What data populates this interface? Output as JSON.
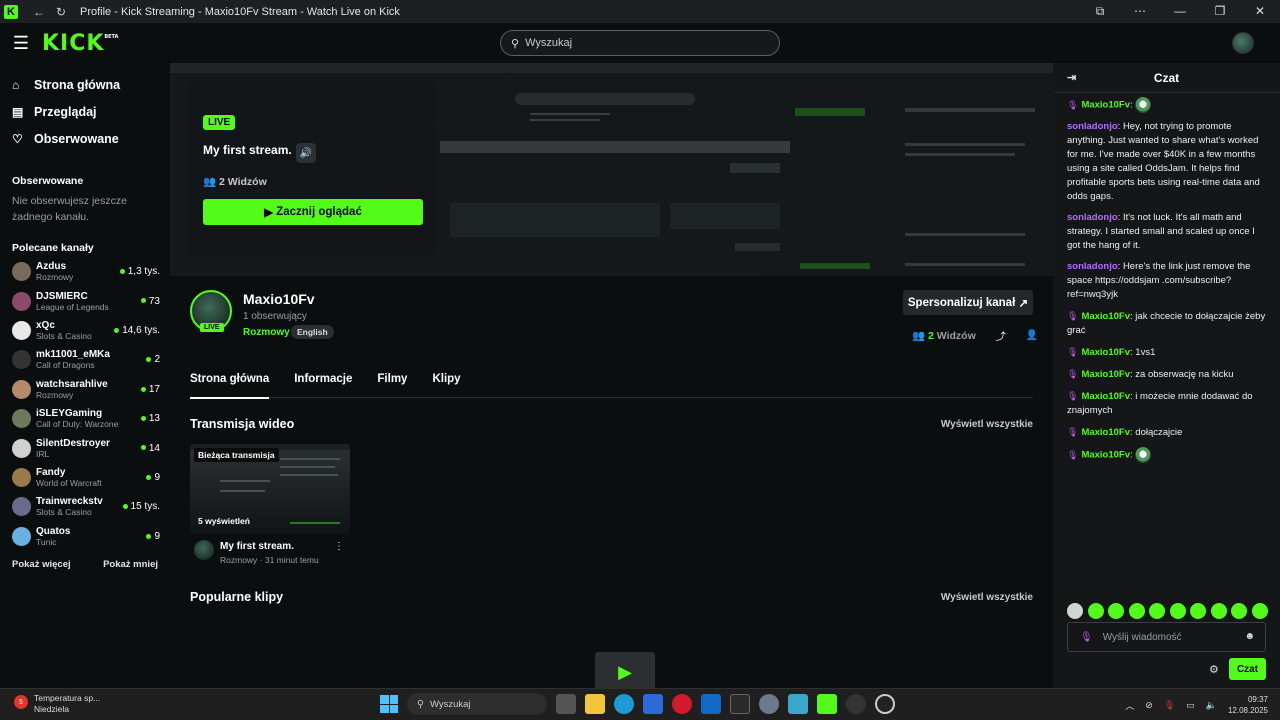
{
  "browser": {
    "title": "Profile - Kick Streaming - Maxio10Fv Stream - Watch Live on Kick"
  },
  "topnav": {
    "logo": "KICK",
    "logo_badge": "BETA",
    "search_placeholder": "Wyszukaj"
  },
  "sidebar": {
    "nav": [
      {
        "label": "Strona główna",
        "icon": "home-icon"
      },
      {
        "label": "Przeglądaj",
        "icon": "browse-icon"
      },
      {
        "label": "Obserwowane",
        "icon": "heart-icon"
      }
    ],
    "following_header": "Obserwowane",
    "following_empty": "Nie obserwujesz jeszcze żadnego kanału.",
    "recommended_header": "Polecane kanały",
    "channels": [
      {
        "name": "Azdus",
        "category": "Rozmowy",
        "viewers": "1,3 tys.",
        "color": "#7a6a5a"
      },
      {
        "name": "DJSMIERC",
        "category": "League of Legends",
        "viewers": "73",
        "color": "#8a4a6a"
      },
      {
        "name": "xQc",
        "category": "Slots & Casino",
        "viewers": "14,6 tys.",
        "color": "#e8e8e8"
      },
      {
        "name": "mk11001_eMKa",
        "category": "Call of Dragons",
        "viewers": "2",
        "color": "#333333"
      },
      {
        "name": "watchsarahlive",
        "category": "Rozmowy",
        "viewers": "17",
        "color": "#b38a6a"
      },
      {
        "name": "iSLEYGaming",
        "category": "Call of Duty: Warzone",
        "viewers": "13",
        "color": "#6a7a5a"
      },
      {
        "name": "SilentDestroyer",
        "category": "IRL",
        "viewers": "14",
        "color": "#d0d0d0"
      },
      {
        "name": "Fandy",
        "category": "World of Warcraft",
        "viewers": "9",
        "color": "#9a7a4a"
      },
      {
        "name": "Trainwreckstv",
        "category": "Slots & Casino",
        "viewers": "15 tys.",
        "color": "#6a6a8a"
      },
      {
        "name": "Quatos",
        "category": "Tunic",
        "viewers": "9",
        "color": "#6ab0e0"
      }
    ],
    "show_more": "Pokaż więcej",
    "show_less": "Pokaż mniej"
  },
  "player": {
    "live_badge": "LIVE",
    "title": "My first stream.",
    "viewers": "2 Widzów",
    "watch_button": "Zacznij oglądać"
  },
  "profile": {
    "name": "Maxio10Fv",
    "followers": "1 obserwujący",
    "category": "Rozmowy",
    "language": "English",
    "live_badge": "LIVE",
    "customize_button": "Spersonalizuj kanał",
    "viewers_count": "2",
    "viewers_label": "Widzów"
  },
  "tabs": [
    "Strona główna",
    "Informacje",
    "Filmy",
    "Klipy"
  ],
  "videos_section": {
    "title": "Transmisja wideo",
    "see_all": "Wyświetl wszystkie",
    "video": {
      "badge": "Bieżąca transmisja",
      "views": "5 wyświetleń",
      "title": "My first stream.",
      "meta": "Rozmowy · 31 minut temu"
    }
  },
  "clips_section": {
    "title": "Popularne klipy",
    "see_all": "Wyświetl wszystkie"
  },
  "chat": {
    "title": "Czat",
    "messages": [
      {
        "user": "Maxio10Fv",
        "type": "owner",
        "text": ":",
        "emote": true
      },
      {
        "user": "sonladonjo",
        "type": "viewer",
        "text": ": Hey, not trying to promote anything. Just wanted to share what's worked for me. I've made over $40K in a few months using a site called OddsJam. It helps find profitable sports bets using real-time data and odds gaps.",
        "emote": false
      },
      {
        "user": "sonladonjo",
        "type": "viewer",
        "text": ": It's not luck. It's all math and strategy. I started small and scaled up once I got the hang of it.",
        "emote": false
      },
      {
        "user": "sonladonjo",
        "type": "viewer",
        "text": ": Here's the link just remove the space https://oddsjam .com/subscribe?ref=nwq3yjk",
        "emote": false
      },
      {
        "user": "Maxio10Fv",
        "type": "owner",
        "text": ": jak chcecie to dołączajcie żeby grać",
        "emote": false
      },
      {
        "user": "Maxio10Fv",
        "type": "owner",
        "text": ": 1vs1",
        "emote": false
      },
      {
        "user": "Maxio10Fv",
        "type": "owner",
        "text": ": za obserwację na kicku",
        "emote": false
      },
      {
        "user": "Maxio10Fv",
        "type": "owner",
        "text": ": i możecie mnie dodawać do znajomych",
        "emote": false
      },
      {
        "user": "Maxio10Fv",
        "type": "owner",
        "text": ": dołączajcie",
        "emote": false
      },
      {
        "user": "Maxio10Fv",
        "type": "owner",
        "text": ":",
        "emote": true
      }
    ],
    "input_placeholder": "Wyślij wiadomość",
    "send_button": "Czat"
  },
  "taskbar": {
    "weather_badge": "5",
    "weather_line1": "Temperatura sp...",
    "weather_line2": "Niedziela",
    "search_placeholder": "Wyszukaj",
    "time": "09:37",
    "date": "12.08.2025"
  },
  "colors": {
    "accent": "#53fc18",
    "background": "#0b0e0f",
    "chat_background": "#141618",
    "viewer_name": "#b46dff"
  }
}
